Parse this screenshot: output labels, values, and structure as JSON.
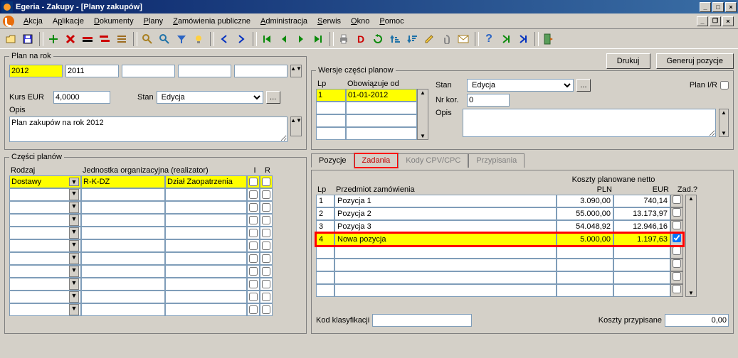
{
  "window_title": "Egeria - Zakupy - [Plany zakupów]",
  "menus": {
    "akcja": "Akcja",
    "aplikacje": "Aplikacje",
    "dokumenty": "Dokumenty",
    "plany": "Plany",
    "zamowienia": "Zamówienia publiczne",
    "administracja": "Administracja",
    "serwis": "Serwis",
    "okno": "Okno",
    "pomoc": "Pomoc"
  },
  "buttons": {
    "drukuj": "Drukuj",
    "generuj": "Generuj pozycje",
    "ellipsis": "..."
  },
  "plan_na_rok": {
    "legend": "Plan na rok",
    "year_highlight": "2012",
    "year_next": "2011",
    "kurs_label": "Kurs EUR",
    "kurs_value": "4,0000",
    "stan_label": "Stan",
    "stan_value": "Edycja",
    "opis_label": "Opis",
    "opis_value": "Plan zakupów na rok 2012"
  },
  "wersje": {
    "legend": "Wersje części planow",
    "lp_hdr": "Lp",
    "obow_hdr": "Obowiązuje od",
    "rows": [
      {
        "lp": "1",
        "obow": "01-01-2012"
      }
    ],
    "stan_label": "Stan",
    "stan_value": "Edycja",
    "nrkor_label": "Nr kor.",
    "nrkor_value": "0",
    "opis_label": "Opis",
    "plan_ir_label": "Plan I/R"
  },
  "czesci": {
    "legend": "Części planów",
    "hdr_rodzaj": "Rodzaj",
    "hdr_jorg": "Jednostka organizacyjna (realizator)",
    "hdr_i": "I",
    "hdr_r": "R",
    "row1_rodzaj": "Dostawy",
    "row1_kod": "R-K-DZ",
    "row1_nazwa": "Dział Zaopatrzenia"
  },
  "tabs": {
    "pozycje": "Pozycje",
    "zadania": "Zadania",
    "kody": "Kody CPV/CPC",
    "przypisania": "Przypisania"
  },
  "pozycje": {
    "hdr_lp": "Lp",
    "hdr_przedmiot": "Przedmiot zamówienia",
    "hdr_koszty": "Koszty planowane netto",
    "hdr_pln": "PLN",
    "hdr_eur": "EUR",
    "hdr_zad": "Zad.?",
    "rows": [
      {
        "lp": "1",
        "subj": "Pozycja 1",
        "pln": "3.090,00",
        "eur": "740,14",
        "zad": false
      },
      {
        "lp": "2",
        "subj": "Pozycja 2",
        "pln": "55.000,00",
        "eur": "13.173,97",
        "zad": false
      },
      {
        "lp": "3",
        "subj": "Pozycja 3",
        "pln": "54.048,92",
        "eur": "12.946,16",
        "zad": false
      },
      {
        "lp": "4",
        "subj": "Nowa pozycja",
        "pln": "5.000,00",
        "eur": "1.197,63",
        "zad": true
      }
    ]
  },
  "bottom": {
    "kod_klas": "Kod klasyfikacji",
    "koszty_przyp": "Koszty przypisane",
    "koszty_val": "0,00"
  }
}
